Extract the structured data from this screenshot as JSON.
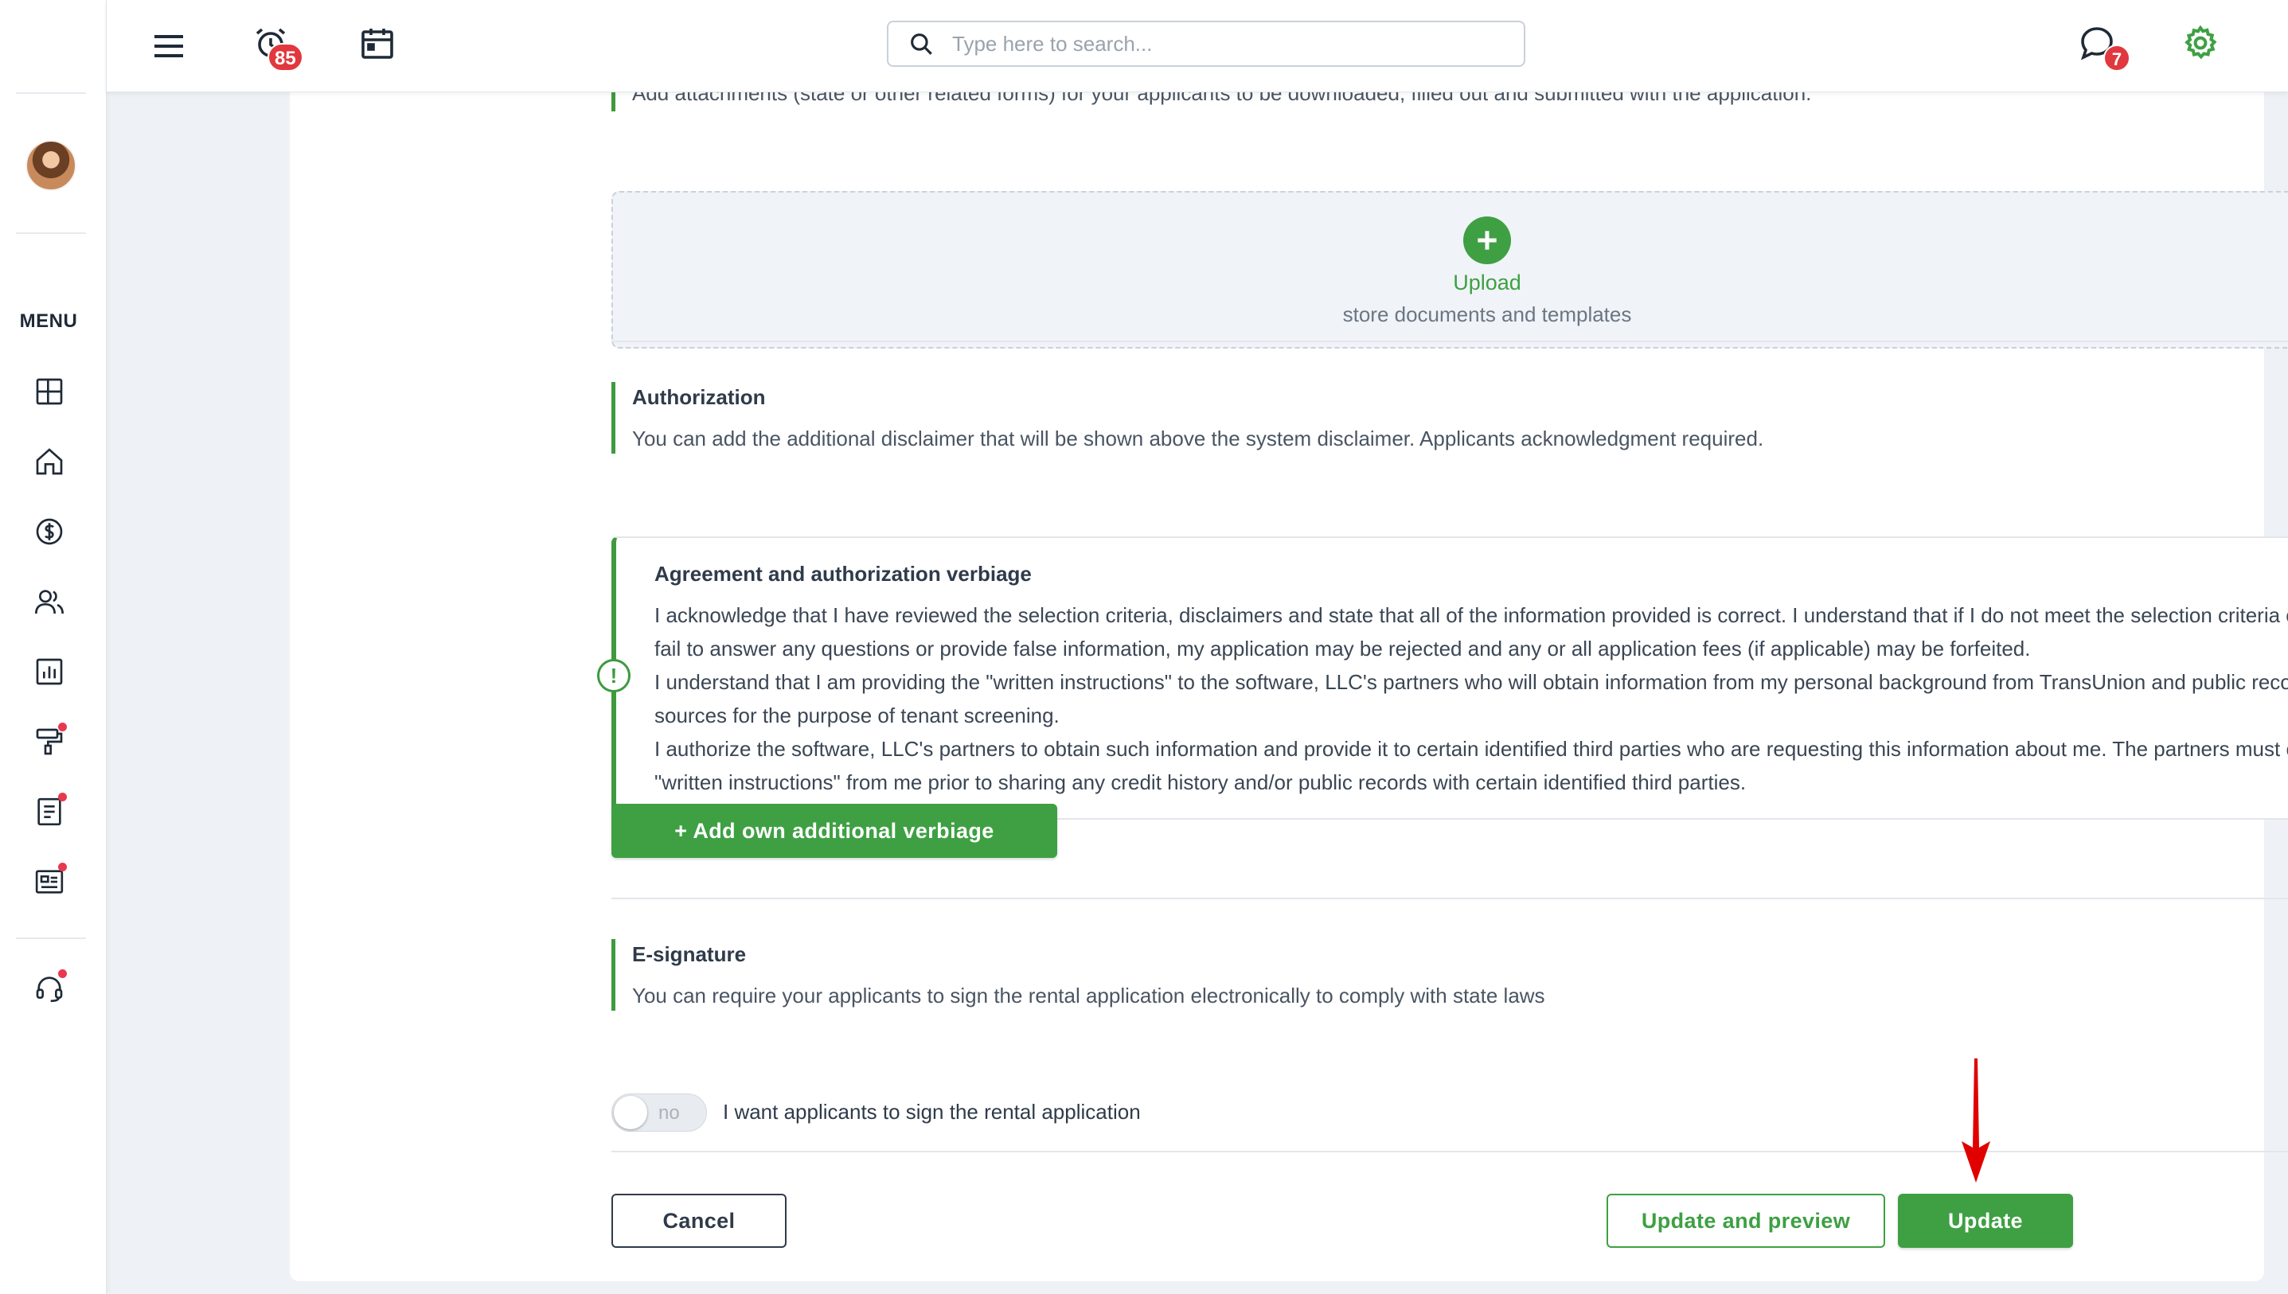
{
  "rail": {
    "menu_label": "MENU",
    "nav_items": [
      {
        "name": "dashboard",
        "icon": "dashboard-icon",
        "dot": false
      },
      {
        "name": "properties",
        "icon": "home-icon",
        "dot": false
      },
      {
        "name": "payments",
        "icon": "dollar-icon",
        "dot": false
      },
      {
        "name": "people",
        "icon": "users-icon",
        "dot": false
      },
      {
        "name": "reports",
        "icon": "chart-icon",
        "dot": false
      },
      {
        "name": "maintenance",
        "icon": "paint-roller-icon",
        "dot": true
      },
      {
        "name": "documents",
        "icon": "document-icon",
        "dot": true
      },
      {
        "name": "listings",
        "icon": "newspaper-icon",
        "dot": true
      },
      {
        "name": "support",
        "icon": "headset-icon",
        "dot": true
      }
    ]
  },
  "topbar": {
    "alerts_count": "85",
    "messages_count": "7",
    "search_placeholder": "Type here to search..."
  },
  "attachments": {
    "description": "Add attachments (state or other related forms) for your applicants to be downloaded, filled out and submitted with the application.",
    "upload_label": "Upload",
    "upload_sub": "store documents and templates"
  },
  "authorization": {
    "title": "Authorization",
    "description": "You can add the additional disclaimer that will be shown above the system disclaimer. Applicants acknowledgment required.",
    "box_title": "Agreement and authorization verbiage",
    "paragraphs": [
      "I acknowledge that I have reviewed the selection criteria, disclaimers and state that all of the information provided is correct. I understand that if I do not meet the selection criteria or if I fail to answer any questions or provide false information, my application may be rejected and any or all application fees (if applicable) may be forfeited.",
      "I understand that I am providing the \"written instructions\" to the software, LLC's partners who will obtain information from my personal background from TransUnion and public records sources for the purpose of tenant screening.",
      "I authorize the software, LLC's partners to obtain such information and provide it to certain identified third parties who are requesting this information about me. The partners must obtain \"written instructions\" from me prior to sharing any credit history and/or public records with certain identified third parties."
    ],
    "add_button": "+ Add own additional verbiage"
  },
  "esignature": {
    "title": "E-signature",
    "description": "You can require your applicants to sign the rental application electronically to comply with state laws",
    "toggle_state": "no",
    "toggle_label": "I want applicants to sign the rental application"
  },
  "footer": {
    "cancel": "Cancel",
    "update_preview": "Update and preview",
    "update": "Update"
  },
  "colors": {
    "accent_green": "#3ea043",
    "badge_red": "#e0383e",
    "annotation_arrow": "#e00000"
  }
}
